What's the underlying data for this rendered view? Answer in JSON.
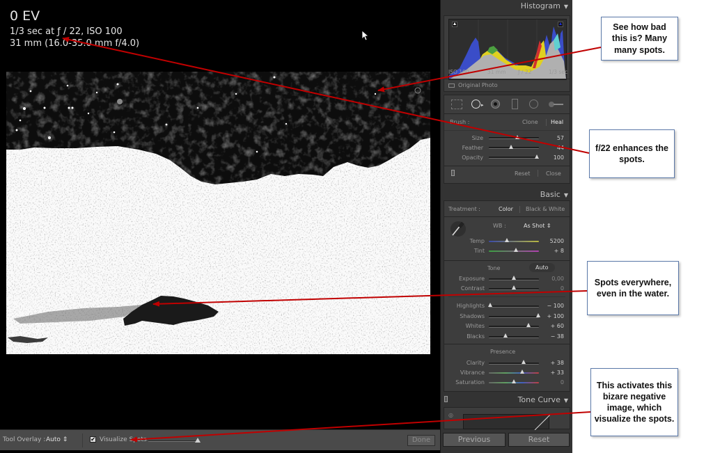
{
  "viewer": {
    "info_ev": "0 EV",
    "info_line1": "1/3 sec at ƒ / 22, ISO 100",
    "info_line2": "31 mm (16.0-35.0 mm f/4.0)"
  },
  "toolbar": {
    "tool_overlay_label": "Tool Overlay :",
    "tool_overlay_value": "Auto ⇕",
    "visualize_spots_checked": "✔",
    "visualize_spots_label": "Visualize Spots",
    "done_label": "Done"
  },
  "histogram": {
    "title": "Histogram",
    "iso": "ISO 100",
    "focal": "31 mm",
    "aperture": "ƒ / 22",
    "shutter": "1/3 sec",
    "original_photo": "Original Photo"
  },
  "spot_tool": {
    "brush_label": "Brush :",
    "clone": "Clone",
    "heal": "Heal",
    "sliders": [
      {
        "label": "Size",
        "value": "57",
        "pos": 0.57
      },
      {
        "label": "Feather",
        "value": "44",
        "pos": 0.44
      },
      {
        "label": "Opacity",
        "value": "100",
        "pos": 1.0
      }
    ],
    "reset": "Reset",
    "close": "Close"
  },
  "basic": {
    "title": "Basic",
    "treatment_label": "Treatment :",
    "color": "Color",
    "bw": "Black & White",
    "wb_label": "WB :",
    "wb_value": "As Shot ⇕",
    "temp": {
      "label": "Temp",
      "value": "5200",
      "pos": 0.35
    },
    "tint": {
      "label": "Tint",
      "value": "+ 8",
      "pos": 0.52
    },
    "tone_label": "Tone",
    "auto": "Auto",
    "exposure": {
      "label": "Exposure",
      "value": "0,00",
      "pos": 0.5
    },
    "contrast": {
      "label": "Contrast",
      "value": "0",
      "pos": 0.5
    },
    "highlights": {
      "label": "Highlights",
      "value": "− 100",
      "pos": 0.0
    },
    "shadows": {
      "label": "Shadows",
      "value": "+ 100",
      "pos": 1.0
    },
    "whites": {
      "label": "Whites",
      "value": "+ 60",
      "pos": 0.8
    },
    "blacks": {
      "label": "Blacks",
      "value": "− 38",
      "pos": 0.31
    },
    "presence_label": "Presence",
    "clarity": {
      "label": "Clarity",
      "value": "+ 38",
      "pos": 0.69
    },
    "vibrance": {
      "label": "Vibrance",
      "value": "+ 33",
      "pos": 0.665
    },
    "saturation": {
      "label": "Saturation",
      "value": "0",
      "pos": 0.5
    }
  },
  "tone_curve": {
    "title": "Tone Curve"
  },
  "bottom_buttons": {
    "previous": "Previous",
    "reset": "Reset"
  },
  "annotations": [
    "See how bad this is? Many many spots.",
    "f/22 enhances the spots.",
    "Spots everywhere, even in the water.",
    "This activates this bizare negative image, which visualize the spots."
  ],
  "colors": {
    "arrow": "#c00000",
    "note_border": "#5a78a8",
    "panel_bg": "#333333"
  }
}
